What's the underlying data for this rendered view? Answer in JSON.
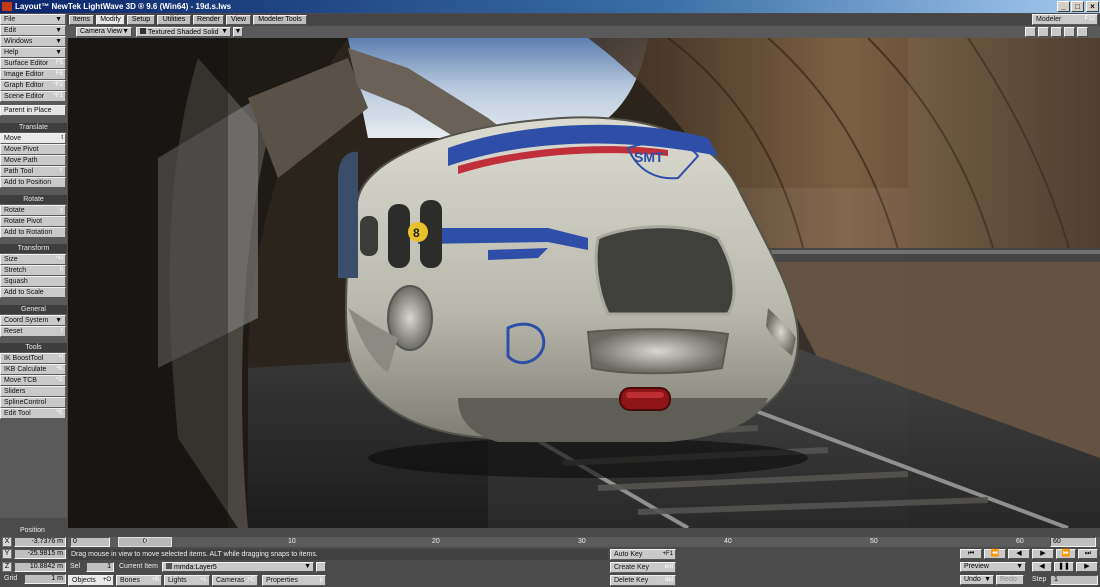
{
  "window": {
    "title": "Layout™ NewTek LightWave 3D ® 9.6  (Win64) - 19d.s.lws",
    "minimize": "_",
    "maximize": "□",
    "close": "×"
  },
  "menus": [
    "File",
    "Edit",
    "Windows",
    "Help"
  ],
  "editors": [
    {
      "label": "Surface Editor",
      "shortcut": "F5"
    },
    {
      "label": "Image Editor",
      "shortcut": "F6"
    },
    {
      "label": "Graph Editor",
      "shortcut": "^F2"
    },
    {
      "label": "Scene Editor",
      "shortcut": "^F1"
    }
  ],
  "parent_in_place": "Parent in Place",
  "sections": {
    "translate": {
      "header": "Translate",
      "items": [
        {
          "label": "Move",
          "shortcut": "t"
        },
        {
          "label": "Move Pivot",
          "shortcut": ""
        },
        {
          "label": "Move Path",
          "shortcut": ""
        },
        {
          "label": "Path Tool",
          "shortcut": "Y"
        },
        {
          "label": "Add to Position",
          "shortcut": ""
        }
      ]
    },
    "rotate": {
      "header": "Rotate",
      "items": [
        {
          "label": "Rotate",
          "shortcut": "y"
        },
        {
          "label": "Rotate Pivot",
          "shortcut": ""
        },
        {
          "label": "Add to Rotation",
          "shortcut": ""
        }
      ]
    },
    "transform": {
      "header": "Transform",
      "items": [
        {
          "label": "Size",
          "shortcut": "^H"
        },
        {
          "label": "Stretch",
          "shortcut": "h"
        },
        {
          "label": "Squash",
          "shortcut": ""
        },
        {
          "label": "Add to Scale",
          "shortcut": ""
        }
      ]
    },
    "general": {
      "header": "General",
      "items": [
        {
          "label": "Coord System",
          "shortcut": ""
        },
        {
          "label": "Reset",
          "shortcut": "r"
        }
      ]
    },
    "tools": {
      "header": "Tools",
      "items": [
        {
          "label": "IK BoostTool",
          "shortcut": "^I"
        },
        {
          "label": "IKB Calculate",
          "shortcut": "^K"
        },
        {
          "label": "Move TCB",
          "shortcut": "^G"
        },
        {
          "label": "Sliders",
          "shortcut": ""
        },
        {
          "label": "SplineControl",
          "shortcut": ""
        },
        {
          "label": "Edit Tool",
          "shortcut": "^E"
        }
      ]
    }
  },
  "tabs": [
    "Items",
    "Modify",
    "Setup",
    "Utilities",
    "Render",
    "View",
    "Modeler Tools"
  ],
  "active_tab": "Modify",
  "modeler": {
    "label": "Modeler",
    "shortcut": "F12"
  },
  "viewport": {
    "view_mode": "Camera View",
    "render_mode": "Textured Shaded Solid",
    "vehicle_number": "8",
    "vehicle_logo": "SMT"
  },
  "timeline": {
    "start": "0",
    "end": "60",
    "current": "0",
    "ticks": [
      "0",
      "10",
      "20",
      "30",
      "40",
      "50",
      "60"
    ]
  },
  "position": {
    "label": "Position",
    "x": "-3.7376 m",
    "y": "-25.9815 m",
    "z": "10.8842 m",
    "grid_label": "Grid",
    "grid": "1 m"
  },
  "status_text": "Drag mouse in view to move selected items. ALT while dragging snaps to items.",
  "sel": {
    "label": "Sel",
    "value": "1"
  },
  "current_item": {
    "label": "Current Item",
    "value": "mmda:Layer5"
  },
  "item_types": [
    {
      "label": "Objects",
      "shortcut": "+O"
    },
    {
      "label": "Bones",
      "shortcut": "+B"
    },
    {
      "label": "Lights",
      "shortcut": "+L"
    },
    {
      "label": "Cameras",
      "shortcut": "+C"
    }
  ],
  "properties": {
    "label": "Properties",
    "shortcut": "p"
  },
  "keys": {
    "auto_key": "Auto Key",
    "auto_key_sc": "+F1",
    "create_key": "Create Key",
    "create_key_sc": "ent",
    "delete_key": "Delete Key",
    "delete_key_sc": "del"
  },
  "playback": {
    "mode": "Preview",
    "step_label": "Step",
    "step": "1",
    "undo": "Undo",
    "redo": "Redo",
    "undo_sc": "z"
  },
  "colors": {
    "vehicle_body": "#c7c6bb",
    "stripe_blue": "#2f4ea8",
    "stripe_red": "#c0303a",
    "tunnel_wood": "#7a5c3c",
    "sky": "#9fb7d6"
  }
}
